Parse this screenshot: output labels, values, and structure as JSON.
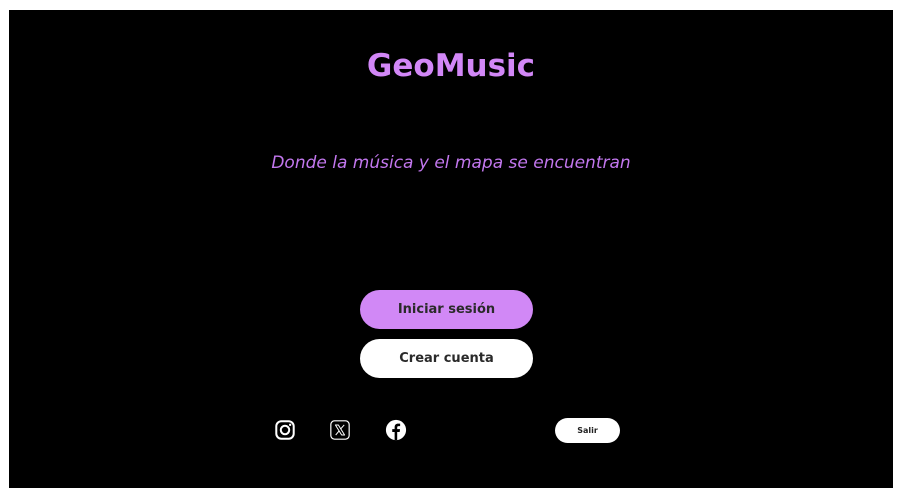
{
  "app": {
    "title": "GeoMusic",
    "tagline": "Donde la música y el mapa se encuentran"
  },
  "actions": {
    "login_label": "Iniciar sesión",
    "register_label": "Crear cuenta",
    "exit_label": "Salir"
  },
  "social": [
    {
      "icon": "instagram-icon"
    },
    {
      "icon": "x-icon"
    },
    {
      "icon": "facebook-icon"
    }
  ],
  "colors": {
    "background": "#000000",
    "accent": "#d188f6",
    "title": "#d287f7",
    "secondary_button": "#ffffff"
  }
}
